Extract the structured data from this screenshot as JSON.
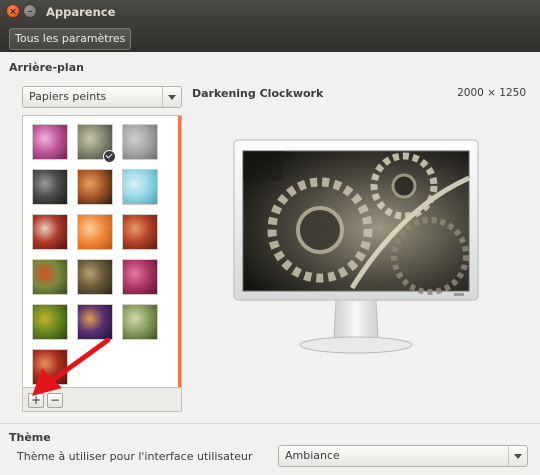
{
  "window": {
    "title": "Apparence",
    "close_glyph": "×",
    "minimize_glyph": "–"
  },
  "toolbar": {
    "all_settings_label": "Tous les paramètres"
  },
  "background": {
    "section_title": "Arrière-plan",
    "source_selected": "Papiers peints",
    "selected_name": "Darkening Clockwork",
    "selected_size": "2000 × 1250",
    "add_label": "+",
    "remove_label": "−",
    "thumbnails": [
      {
        "name": "pink-bokeh",
        "colors": [
          "#6b1e4a",
          "#c0589a",
          "#f0b4d8"
        ]
      },
      {
        "name": "darkening-clockwork",
        "colors": [
          "#3d3f33",
          "#8a8b73",
          "#c8c6b0"
        ],
        "selected": true
      },
      {
        "name": "grey-leaf",
        "colors": [
          "#6e6e6e",
          "#a8a8a8",
          "#d0d0d0"
        ]
      },
      {
        "name": "dark-abstract",
        "colors": [
          "#1a1a1a",
          "#4b4b4b",
          "#9a9a9a"
        ]
      },
      {
        "name": "sunset-field",
        "colors": [
          "#2a1a10",
          "#a8582a",
          "#e8a060"
        ]
      },
      {
        "name": "cyan-drops",
        "colors": [
          "#4aa0b8",
          "#9ad8e6",
          "#d6f2f6"
        ]
      },
      {
        "name": "red-trees",
        "colors": [
          "#4a1410",
          "#b03a2a",
          "#e8d0c0"
        ]
      },
      {
        "name": "orange-leaves",
        "colors": [
          "#c05010",
          "#f08a3a",
          "#ffd0a0"
        ]
      },
      {
        "name": "red-landscape",
        "colors": [
          "#5a1a10",
          "#b8442a",
          "#e89a6a"
        ]
      },
      {
        "name": "poppies",
        "colors": [
          "#3a4a20",
          "#7a8a40",
          "#d8502a"
        ]
      },
      {
        "name": "fountain-pen",
        "colors": [
          "#2a2418",
          "#6a5a3a",
          "#b8a070"
        ]
      },
      {
        "name": "magenta-bokeh",
        "colors": [
          "#5a1030",
          "#b03868",
          "#e07aa0"
        ]
      },
      {
        "name": "green-flowers",
        "colors": [
          "#2a4010",
          "#6a8a20",
          "#c8b030"
        ]
      },
      {
        "name": "night-sky",
        "colors": [
          "#1a1040",
          "#5a3070",
          "#e0a050"
        ]
      },
      {
        "name": "grass",
        "colors": [
          "#3a5020",
          "#8aa060",
          "#d0d8b0"
        ]
      },
      {
        "name": "red-flowers",
        "colors": [
          "#5a1010",
          "#a83020",
          "#e89060"
        ]
      }
    ]
  },
  "theme": {
    "section_title": "Thème",
    "description": "Thème à utiliser pour l'interface utilisateur",
    "selected": "Ambiance"
  },
  "colors": {
    "accent": "#f07746",
    "annotation_arrow": "#e4161c",
    "titlebar": "#3c3b37"
  }
}
